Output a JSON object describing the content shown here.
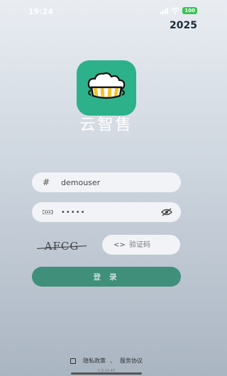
{
  "status_bar": {
    "time": "19:24",
    "battery": "100"
  },
  "year_badge": "2025",
  "app": {
    "title": "云智售"
  },
  "login_form": {
    "username_icon": "#",
    "username_value": "demouser",
    "password_value": "•••••",
    "captcha_image_text": "AFCG",
    "captcha_icon": "<>",
    "captcha_placeholder": "验证码",
    "login_label": "登 录"
  },
  "footer": {
    "privacy_label": "隐私政策",
    "separator": "、",
    "service_label": "服务协议",
    "version": "1.0.14-40"
  },
  "colors": {
    "accent": "#3f8f7a",
    "logo_bg": "#2db18a",
    "battery": "#3ac452"
  },
  "icons": [
    "signal-icon",
    "wifi-icon",
    "battery-icon",
    "storefront-cloud-icon",
    "hash-icon",
    "password-dots-icon",
    "eye-hidden-icon",
    "code-icon",
    "checkbox-icon"
  ]
}
